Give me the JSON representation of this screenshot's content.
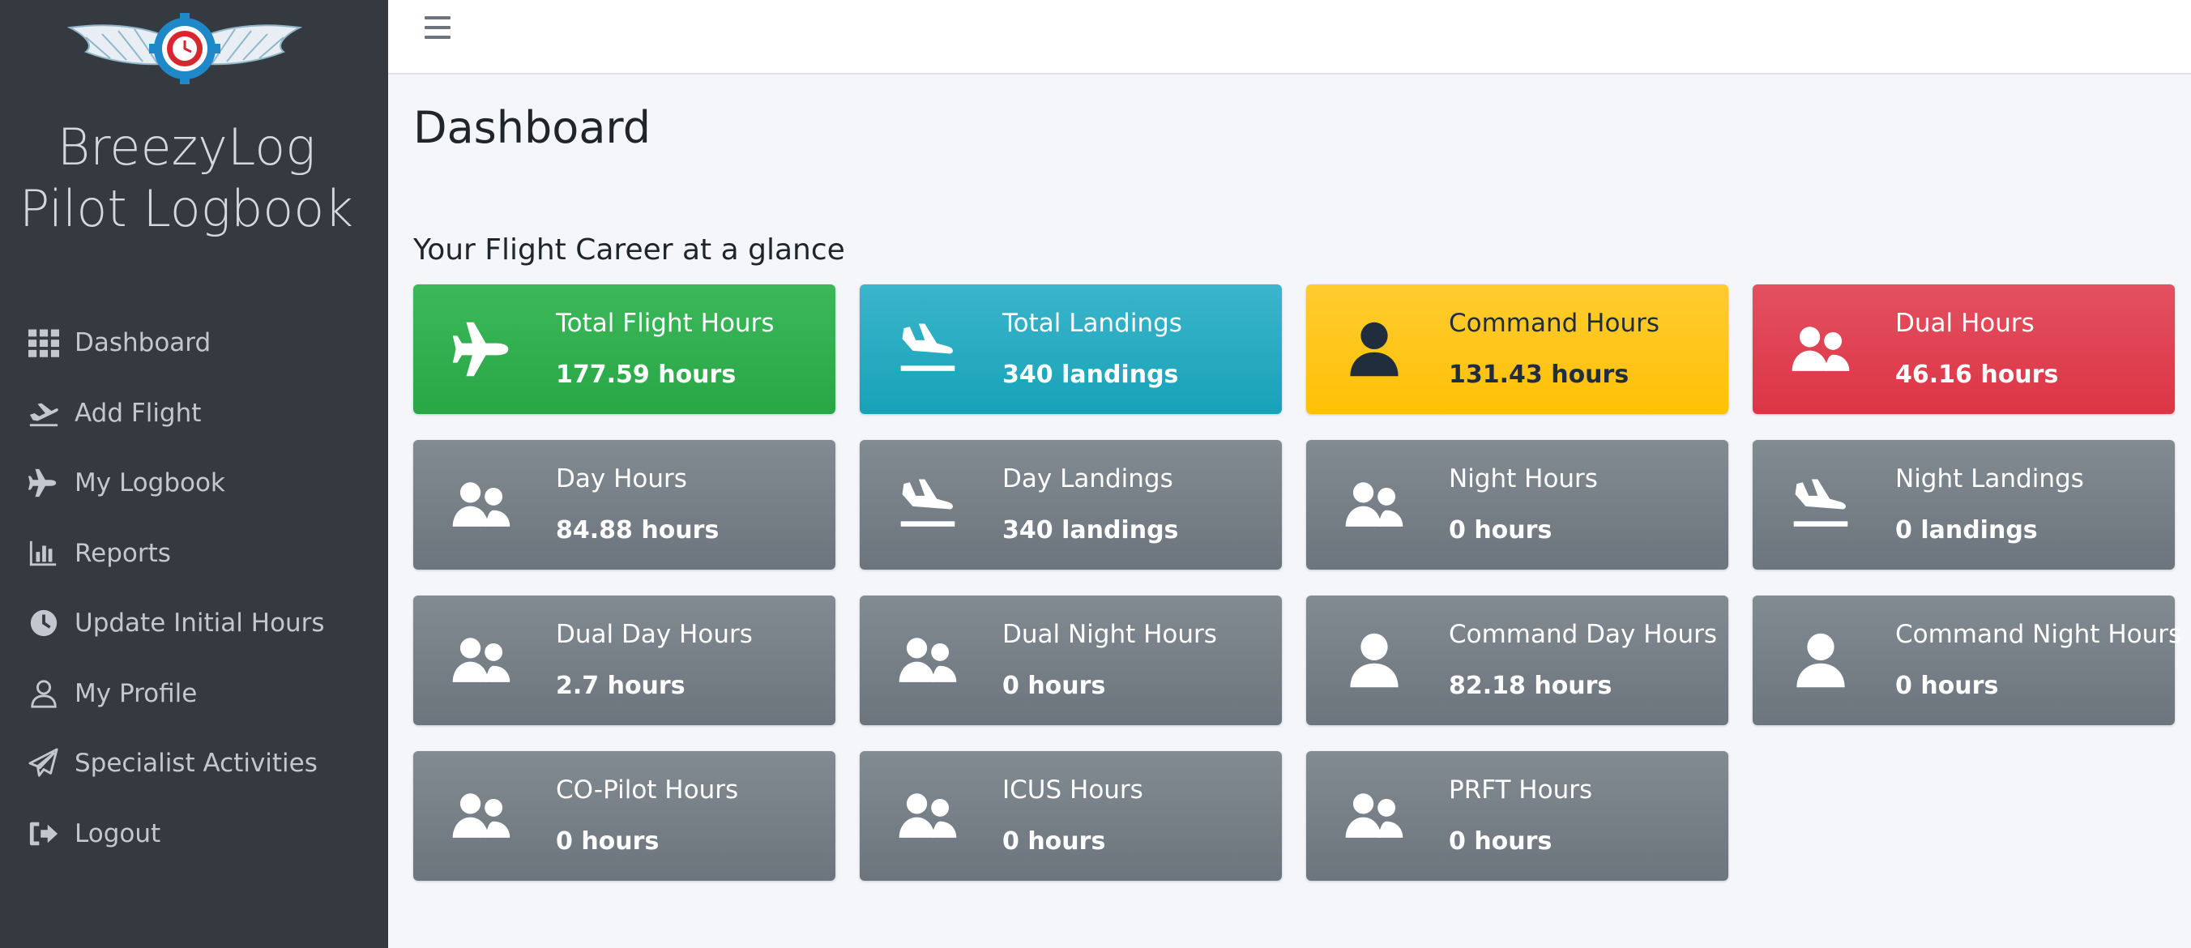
{
  "app": {
    "brand_line1": "BreezyLog",
    "brand_line2": "Pilot Logbook"
  },
  "sidebar": {
    "items": [
      {
        "label": "Dashboard",
        "icon": "grid-icon"
      },
      {
        "label": "Add Flight",
        "icon": "plane-departure-icon"
      },
      {
        "label": "My Logbook",
        "icon": "plane-icon"
      },
      {
        "label": "Reports",
        "icon": "bar-chart-icon"
      },
      {
        "label": "Update Initial Hours",
        "icon": "clock-icon"
      },
      {
        "label": "My Profile",
        "icon": "user-outline-icon"
      },
      {
        "label": "Specialist Activities",
        "icon": "paper-plane-icon"
      },
      {
        "label": "Logout",
        "icon": "sign-out-icon"
      }
    ]
  },
  "main": {
    "title": "Dashboard",
    "subtitle": "Your Flight Career at a glance",
    "cards": [
      {
        "label": "Total Flight Hours",
        "value": "177.59 hours",
        "icon": "plane-icon",
        "color": "#28a745"
      },
      {
        "label": "Total Landings",
        "value": "340 landings",
        "icon": "plane-arrival-icon",
        "color": "#17a2b8"
      },
      {
        "label": "Command Hours",
        "value": "131.43 hours",
        "icon": "user-icon",
        "color": "#ffc107"
      },
      {
        "label": "Dual Hours",
        "value": "46.16 hours",
        "icon": "users-icon",
        "color": "#dc3545"
      },
      {
        "label": "Day Hours",
        "value": "84.88 hours",
        "icon": "users-icon",
        "color": "#6c757d"
      },
      {
        "label": "Day Landings",
        "value": "340 landings",
        "icon": "plane-arrival-icon",
        "color": "#6c757d"
      },
      {
        "label": "Night Hours",
        "value": "0 hours",
        "icon": "users-icon",
        "color": "#6c757d"
      },
      {
        "label": "Night Landings",
        "value": "0 landings",
        "icon": "plane-arrival-icon",
        "color": "#6c757d"
      },
      {
        "label": "Dual Day Hours",
        "value": "2.7 hours",
        "icon": "users-icon",
        "color": "#6c757d"
      },
      {
        "label": "Dual Night Hours",
        "value": "0 hours",
        "icon": "users-icon",
        "color": "#6c757d"
      },
      {
        "label": "Command Day Hours",
        "value": "82.18 hours",
        "icon": "user-icon",
        "color": "#6c757d"
      },
      {
        "label": "Command Night Hours",
        "value": "0 hours",
        "icon": "user-icon",
        "color": "#6c757d"
      },
      {
        "label": "CO-Pilot Hours",
        "value": "0 hours",
        "icon": "users-icon",
        "color": "#6c757d"
      },
      {
        "label": "ICUS Hours",
        "value": "0 hours",
        "icon": "users-icon",
        "color": "#6c757d"
      },
      {
        "label": "PRFT Hours",
        "value": "0 hours",
        "icon": "users-icon",
        "color": "#6c757d"
      }
    ]
  }
}
